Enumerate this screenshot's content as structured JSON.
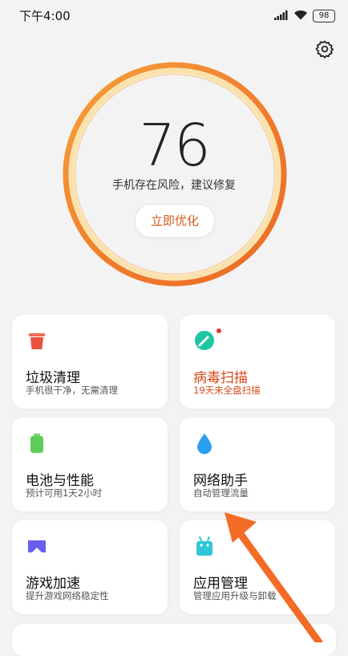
{
  "status_bar": {
    "time": "下午4:00",
    "battery": "98"
  },
  "score": {
    "value": "76",
    "description": "手机存在风险，建议修复",
    "action_label": "立即优化"
  },
  "tools": [
    {
      "title": "垃圾清理",
      "subtitle": "手机很干净，无需清理",
      "icon": "trash-icon"
    },
    {
      "title": "病毒扫描",
      "subtitle": "19天未全盘扫描",
      "icon": "virus-scan-icon",
      "alert": true
    },
    {
      "title": "电池与性能",
      "subtitle": "预计可用1天2小时",
      "icon": "battery-icon"
    },
    {
      "title": "网络助手",
      "subtitle": "自动管理流量",
      "icon": "droplet-icon"
    },
    {
      "title": "游戏加速",
      "subtitle": "提升游戏网络稳定性",
      "icon": "gamepad-icon"
    },
    {
      "title": "应用管理",
      "subtitle": "管理应用升级与卸载",
      "icon": "android-icon"
    }
  ],
  "colors": {
    "accent": "#f07a2a",
    "alert": "#d9481a",
    "ring_inner": "#fbe2a8"
  }
}
